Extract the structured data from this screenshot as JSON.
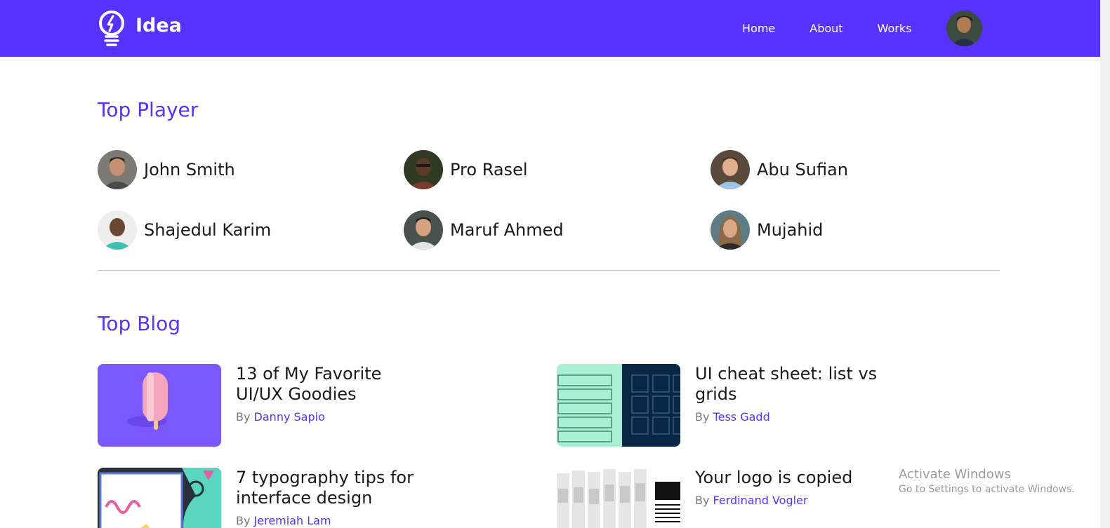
{
  "navbar": {
    "logo_text": "Idea",
    "links": [
      {
        "label": "Home"
      },
      {
        "label": "About"
      },
      {
        "label": "Works"
      }
    ],
    "brand_color": "#5731fd"
  },
  "top_player": {
    "title": "Top Player",
    "players": [
      {
        "name": "John Smith"
      },
      {
        "name": "Pro Rasel"
      },
      {
        "name": "Abu Sufian"
      },
      {
        "name": "Shajedul Karim"
      },
      {
        "name": "Maruf Ahmed"
      },
      {
        "name": "Mujahid"
      }
    ]
  },
  "top_blog": {
    "title": "Top Blog",
    "by_label": "By",
    "posts": [
      {
        "title": "13 of My Favorite UI/UX Goodies",
        "author": "Danny Sapio"
      },
      {
        "title": "UI cheat sheet: list vs grids",
        "author": "Tess Gadd"
      },
      {
        "title": "7 typography tips for interface design",
        "author": "Jeremiah Lam"
      },
      {
        "title": "Your logo is copied",
        "author": "Ferdinand Vogler"
      }
    ]
  },
  "watermark": {
    "title": "Activate Windows",
    "subtitle": "Go to Settings to activate Windows."
  }
}
